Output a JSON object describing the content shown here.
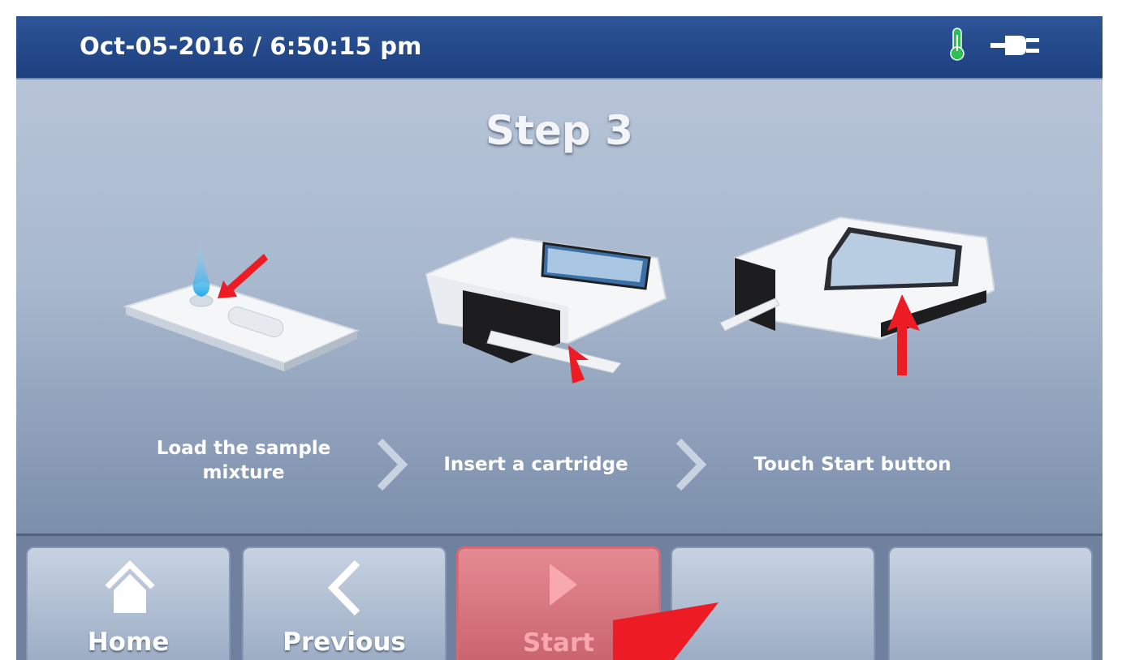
{
  "status_bar": {
    "datetime": "Oct-05-2016 / 6:50:15 pm",
    "icons": [
      "thermometer-icon",
      "power-plug-icon"
    ],
    "colors": {
      "background": "#24498a",
      "thermometer": "#22b24c"
    }
  },
  "main": {
    "title": "Step 3",
    "steps": [
      {
        "label": "Load the sample mixture",
        "illustration": "cartridge-with-sample-drop"
      },
      {
        "label": "Insert a cartridge",
        "illustration": "device-with-cartridge-inserted"
      },
      {
        "label": "Touch Start button",
        "illustration": "device-touchscreen"
      }
    ]
  },
  "nav": {
    "home_label": "Home",
    "previous_label": "Previous",
    "start_label": "Start",
    "start_color": "#d46a76"
  },
  "accent": {
    "pointer_arrow": "#ed1c24"
  }
}
